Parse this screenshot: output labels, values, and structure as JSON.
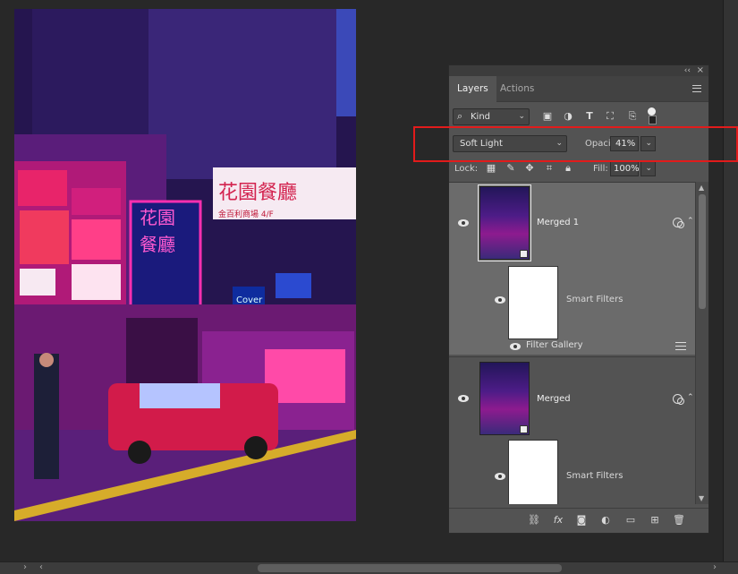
{
  "panel": {
    "tabs": [
      {
        "label": "Layers",
        "active": true
      },
      {
        "label": "Actions",
        "active": false
      }
    ],
    "collapse_glyph": "‹‹",
    "close_glyph": "×"
  },
  "filter": {
    "kind_label": "Kind",
    "icons": [
      "image-filter-icon",
      "adjustment-filter-icon",
      "type-filter-icon",
      "shape-filter-icon",
      "smart-object-filter-icon"
    ]
  },
  "blend": {
    "mode": "Soft Light",
    "opacity_label": "Opacity:",
    "opacity_value": "41%"
  },
  "lock": {
    "label": "Lock:",
    "fill_label": "Fill:",
    "fill_value": "100%"
  },
  "layers": [
    {
      "name": "Merged 1",
      "selected": true,
      "sub": {
        "label": "Smart Filters",
        "filter": "Filter Gallery"
      }
    },
    {
      "name": "Merged",
      "selected": false,
      "sub": {
        "label": "Smart Filters"
      }
    }
  ],
  "canvas": {
    "signs": [
      "花園餐廳",
      "金百利商場 4/F",
      "花園",
      "餐廳",
      "Cover"
    ]
  },
  "colors": {
    "panel_bg": "#535353",
    "workspace_bg": "#282828",
    "highlight": "#e21b1b",
    "selected_row": "#6b6b6b"
  }
}
